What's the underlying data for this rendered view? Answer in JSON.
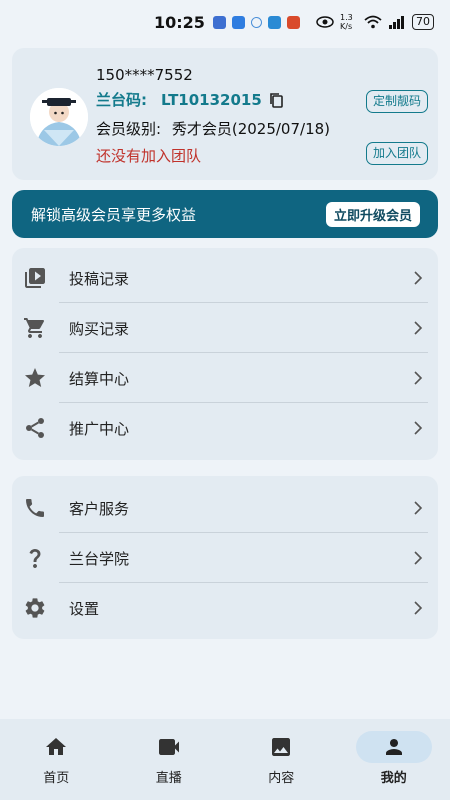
{
  "status_bar": {
    "time": "10:25",
    "network_speed": "1.3 K/s",
    "battery": "70"
  },
  "profile": {
    "phone": "150****7552",
    "code_label": "兰台码:",
    "code_value": "LT10132015",
    "level_label": "会员级别:",
    "level_value": "秀才会员(2025/07/18)",
    "team_status": "还没有加入团队",
    "custom_code_button": "定制靓码",
    "join_team_button": "加入团队"
  },
  "upgrade": {
    "text": "解锁高级会员享更多权益",
    "button": "立即升级会员"
  },
  "menu_group_1": [
    {
      "label": "投稿记录",
      "icon": "video-library-icon"
    },
    {
      "label": "购买记录",
      "icon": "cart-icon"
    },
    {
      "label": "结算中心",
      "icon": "star-icon"
    },
    {
      "label": "推广中心",
      "icon": "share-icon"
    }
  ],
  "menu_group_2": [
    {
      "label": "客户服务",
      "icon": "phone-icon"
    },
    {
      "label": "兰台学院",
      "icon": "question-icon"
    },
    {
      "label": "设置",
      "icon": "gear-icon"
    }
  ],
  "bottom_nav": [
    {
      "label": "首页",
      "icon": "home-icon"
    },
    {
      "label": "直播",
      "icon": "video-camera-icon"
    },
    {
      "label": "内容",
      "icon": "image-icon"
    },
    {
      "label": "我的",
      "icon": "person-icon",
      "active": true
    }
  ],
  "colors": {
    "accent": "#137a8c",
    "banner": "#0f6581",
    "warning": "#c0322b",
    "card": "#e3ebf2"
  }
}
